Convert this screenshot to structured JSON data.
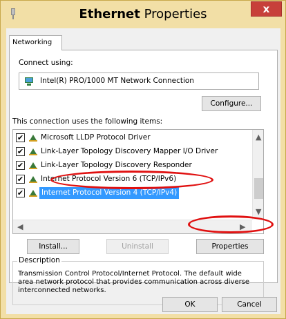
{
  "window": {
    "title_bold": "Ethernet",
    "title_rest": " Properties",
    "close_label": "x"
  },
  "tab": {
    "label": "Networking"
  },
  "connect": {
    "label": "Connect using:",
    "adapter": "Intel(R) PRO/1000 MT Network Connection",
    "configure_label": "Configure..."
  },
  "items_label": "This connection uses the following items:",
  "items": [
    {
      "label": "Microsoft LLDP Protocol Driver",
      "checked": "✔"
    },
    {
      "label": "Link-Layer Topology Discovery Mapper I/O Driver",
      "checked": "✔"
    },
    {
      "label": "Link-Layer Topology Discovery Responder",
      "checked": "✔"
    },
    {
      "label": "Internet Protocol Version 6 (TCP/IPv6)",
      "checked": "✔"
    },
    {
      "label": "Internet Protocol Version 4 (TCP/IPv4)",
      "checked": "✔"
    }
  ],
  "buttons": {
    "install": "Install...",
    "uninstall": "Uninstall",
    "properties": "Properties",
    "ok": "OK",
    "cancel": "Cancel"
  },
  "description": {
    "legend": "Description",
    "text": "Transmission Control Protocol/Internet Protocol. The default wide area network protocol that provides communication across diverse interconnected networks."
  },
  "colors": {
    "titlebar": "#f2dfa6",
    "close": "#c7403a",
    "selection": "#3399ff",
    "annotation": "#e01010"
  }
}
